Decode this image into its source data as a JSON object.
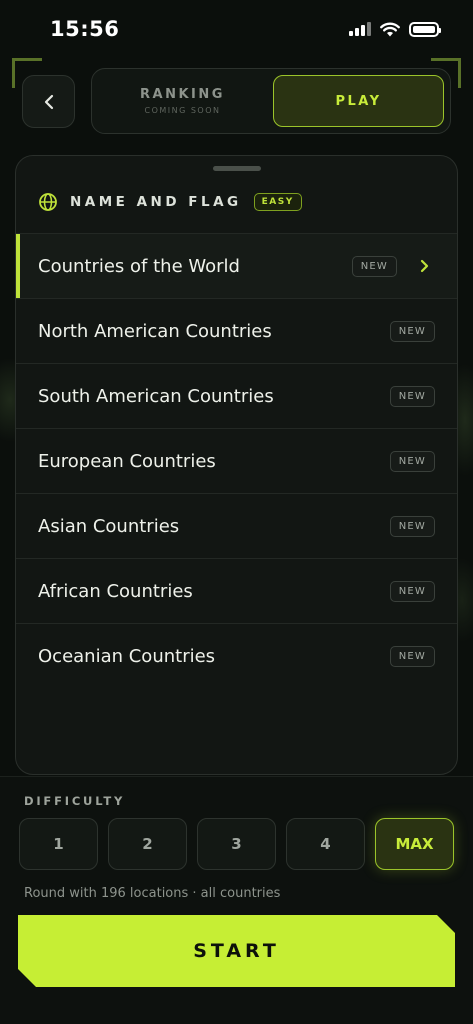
{
  "status_bar": {
    "time": "15:56"
  },
  "header": {
    "back_icon": "chevron-left-icon",
    "ranking_label": "RANKING",
    "ranking_sub": "COMING SOON",
    "play_label": "PLAY"
  },
  "category": {
    "icon": "globe-icon",
    "title": "NAME AND FLAG",
    "level_badge": "EASY"
  },
  "list": {
    "items": [
      {
        "label": "Countries of the World",
        "badge": "NEW"
      },
      {
        "label": "North American Countries",
        "badge": "NEW"
      },
      {
        "label": "South American Countries",
        "badge": "NEW"
      },
      {
        "label": "European Countries",
        "badge": "NEW"
      },
      {
        "label": "Asian Countries",
        "badge": "NEW"
      },
      {
        "label": "African Countries",
        "badge": "NEW"
      },
      {
        "label": "Oceanian Countries",
        "badge": "NEW"
      }
    ]
  },
  "difficulty": {
    "label": "DIFFICULTY",
    "options": [
      "1",
      "2",
      "3",
      "4",
      "MAX"
    ],
    "selected": "MAX"
  },
  "round_info": "Round with 196 locations · all countries",
  "start_label": "START",
  "colors": {
    "accent": "#c6ee34",
    "background": "#0b0f0c",
    "card": "#121613"
  }
}
